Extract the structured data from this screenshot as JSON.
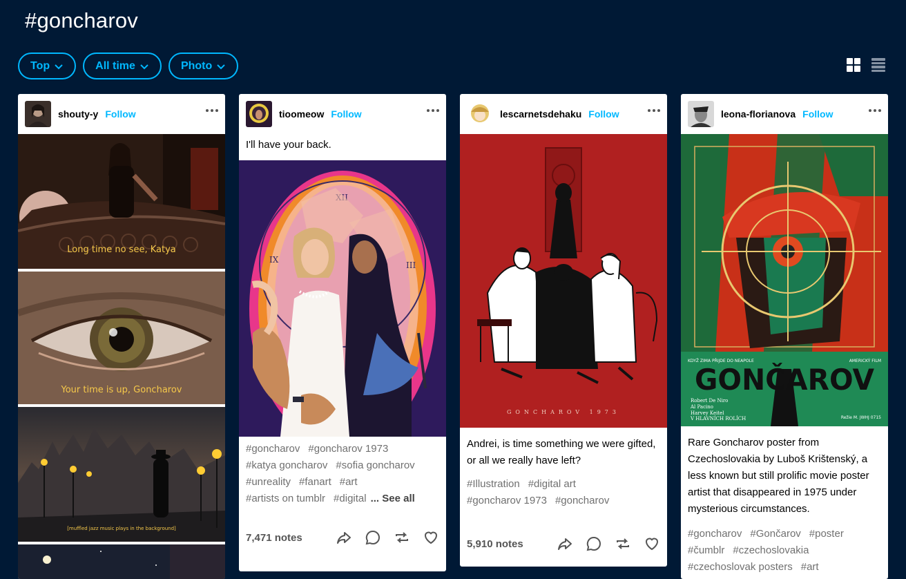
{
  "page": {
    "title": "#goncharov"
  },
  "filters": [
    {
      "label": "Top"
    },
    {
      "label": "All time"
    },
    {
      "label": "Photo"
    }
  ],
  "colors": {
    "background": "#001935",
    "accent": "#00b8ff"
  },
  "icons": {
    "grid_view": "grid-view-icon",
    "list_view": "list-view-icon",
    "chevron": "chevron-down-icon"
  },
  "posts": [
    {
      "blog": "shouty-y",
      "follow": "Follow",
      "subtitles": [
        "Long time no see, Katya",
        "Your time is up, Goncharov",
        "[muffled jazz music plays in the background]"
      ]
    },
    {
      "blog": "tioomeow",
      "follow": "Follow",
      "caption": "I'll have your back.",
      "tags": [
        "#goncharov",
        "#goncharov 1973",
        "#katya goncharov",
        "#sofia goncharov",
        "#unreality",
        "#fanart",
        "#art",
        "#artists on tumblr",
        "#digital"
      ],
      "see_all": "... See all",
      "notes": "7,471 notes"
    },
    {
      "blog": "lescarnetsdehaku",
      "follow": "Follow",
      "image_text": "GONCHAROV 1973",
      "caption": "Andrei, is time something we were gifted, or all we really have left?",
      "tags": [
        "#Illustration",
        "#digital art",
        "#goncharov 1973",
        "#goncharov"
      ],
      "notes": "5,910 notes"
    },
    {
      "blog": "leona-florianova",
      "follow": "Follow",
      "poster": {
        "title": "GONČAROV",
        "top_left": "KDYŽ ZIMA PŘIJDE DO NEAPOLE",
        "top_right": "AMERICKÝ FILM",
        "cast": [
          "Robert De Niro",
          "Al Pacino",
          "Harvey Keitel",
          "V HLAVNÍCH ROLÍCH"
        ],
        "director": "Režie M. JWHJ 0715"
      },
      "caption": "Rare Goncharov poster from Czechoslovakia by Luboš Krištenský, a less known but still prolific movie poster artist that disappeared in 1975 under mysterious circumstances.",
      "tags": [
        "#goncharov",
        "#Gončarov",
        "#poster",
        "#čumblr",
        "#czechoslovakia",
        "#czechoslovak posters",
        "#art"
      ]
    }
  ]
}
